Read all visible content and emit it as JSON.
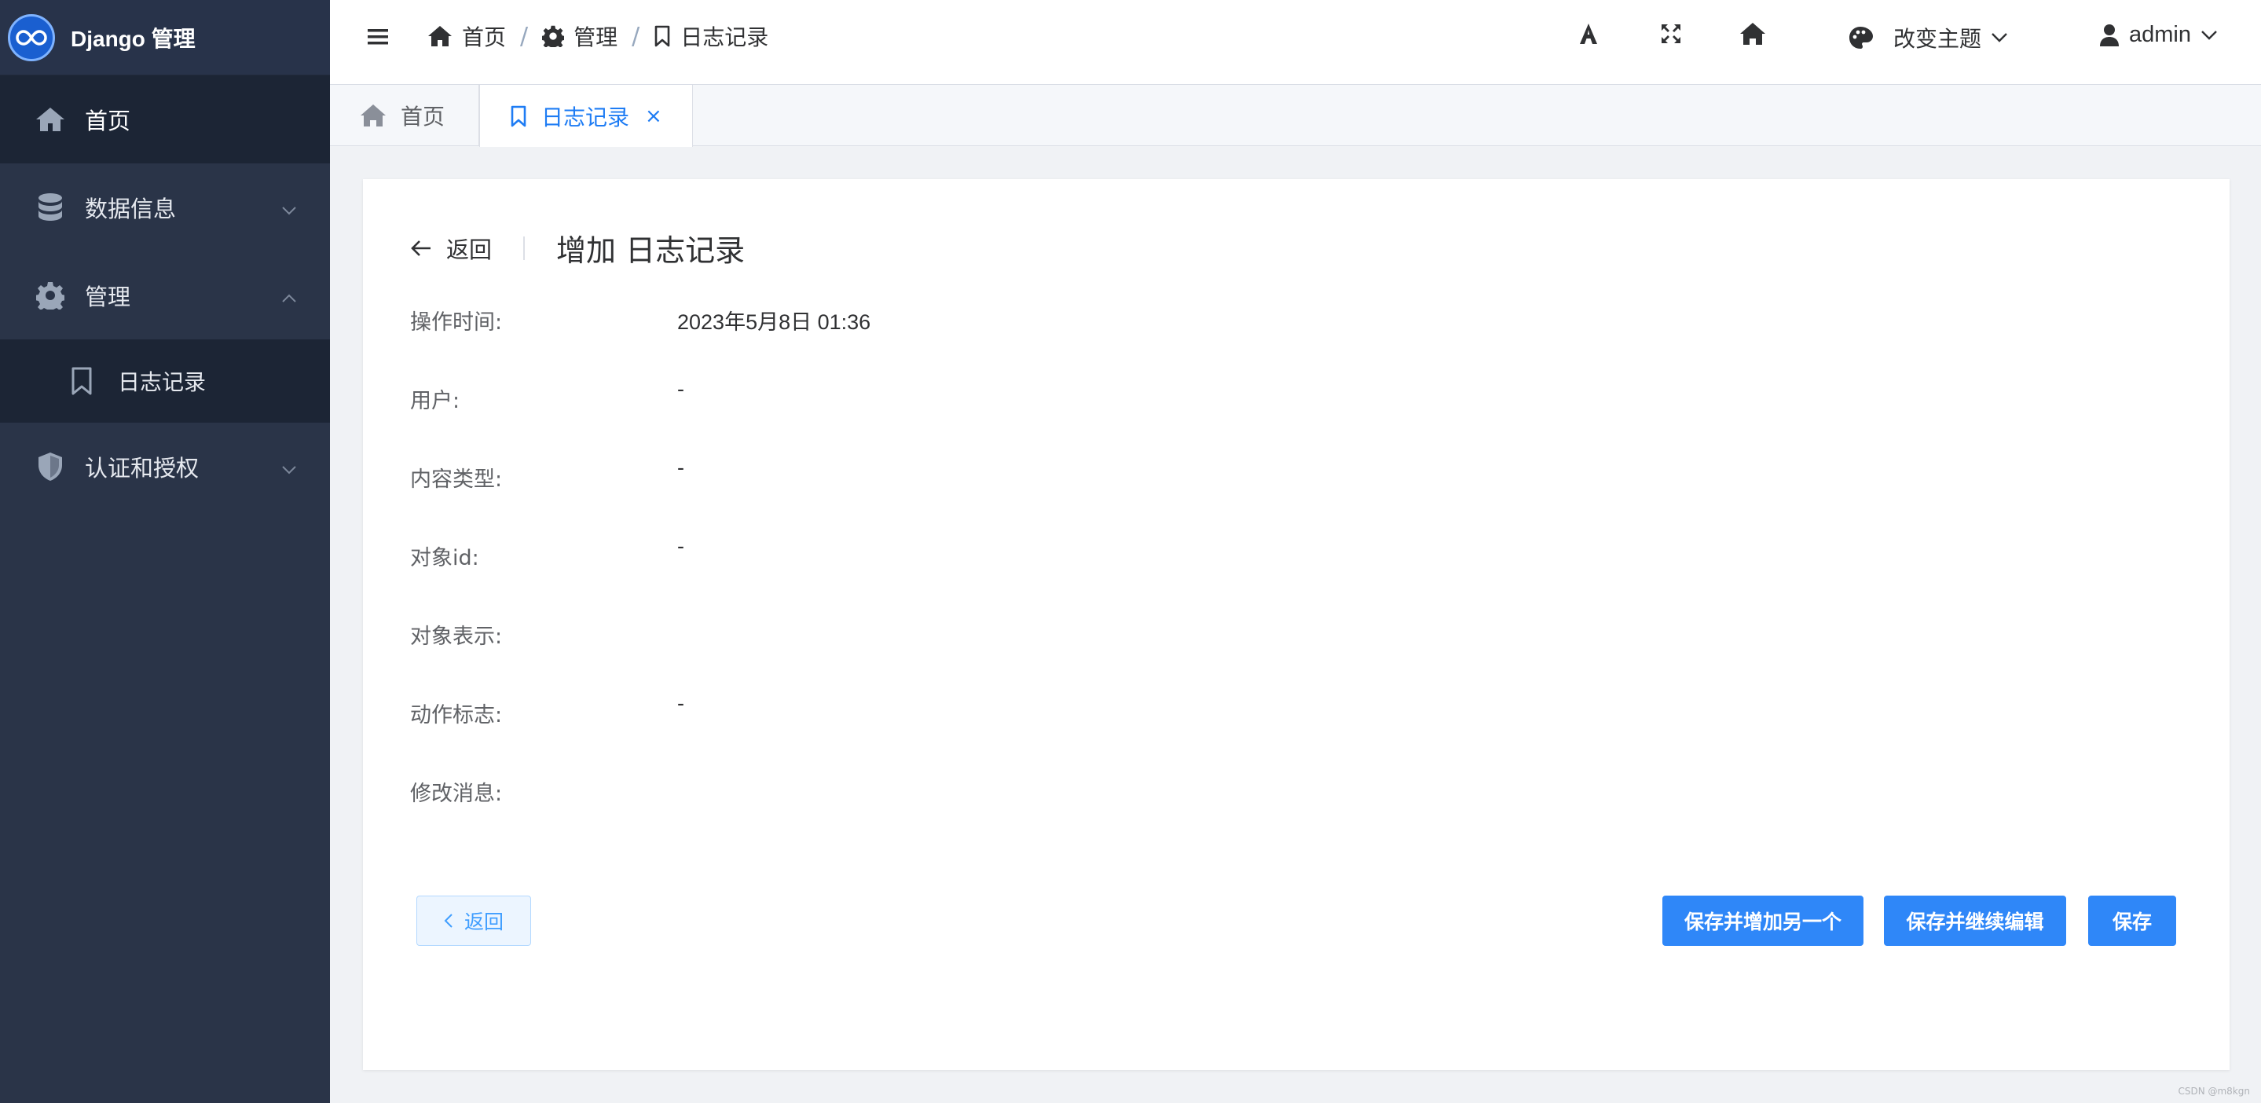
{
  "app": {
    "brand_title": "Django 管理"
  },
  "sidebar": {
    "items": [
      {
        "label": "首页",
        "icon": "home-icon"
      },
      {
        "label": "数据信息",
        "icon": "database-icon"
      },
      {
        "label": "管理",
        "icon": "gear-icon"
      },
      {
        "label": "日志记录",
        "icon": "bookmark-icon"
      },
      {
        "label": "认证和授权",
        "icon": "shield-icon"
      }
    ]
  },
  "header": {
    "breadcrumb": [
      "首页",
      "管理",
      "日志记录"
    ],
    "breadcrumb_sep": "/",
    "theme_label": "改变主题",
    "user_label": "admin"
  },
  "tabs": [
    {
      "label": "首页"
    },
    {
      "label": "日志记录",
      "close": "×"
    }
  ],
  "page": {
    "back_label": "返回",
    "title": "增加 日志记录",
    "fields": [
      {
        "label": "操作时间:",
        "value": "2023年5月8日 01:36"
      },
      {
        "label": "用户:",
        "value": "-"
      },
      {
        "label": "内容类型:",
        "value": "-"
      },
      {
        "label": "对象id:",
        "value": "-"
      },
      {
        "label": "对象表示:",
        "value": ""
      },
      {
        "label": "动作标志:",
        "value": "-"
      },
      {
        "label": "修改消息:",
        "value": ""
      }
    ],
    "buttons": {
      "back": "返回",
      "save_add_another": "保存并增加另一个",
      "save_continue": "保存并继续编辑",
      "save": "保存"
    }
  },
  "footer": {
    "watermark": "CSDN @m8kgn"
  },
  "colors": {
    "sidebar_bg": "#2a3448",
    "sidebar_active_bg": "#1c2535",
    "accent": "#1e7cf4",
    "primary_button": "#2f87f8"
  }
}
